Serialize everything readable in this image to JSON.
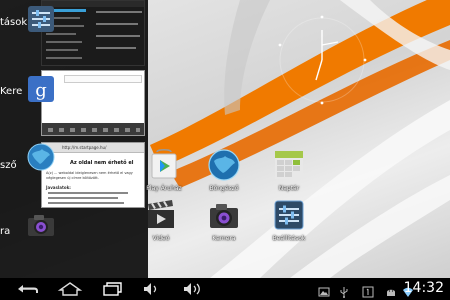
{
  "recents": [
    {
      "label": "tások",
      "icon": "settings-icon"
    },
    {
      "label": "Kere",
      "icon": "google-search-icon"
    },
    {
      "label": "sző",
      "icon": "browser-globe-icon"
    },
    {
      "label": "ra",
      "icon": "camera-icon"
    }
  ],
  "browser_thumb": {
    "url": "http://m.startpage.hu/",
    "heading": "Az oldal nem érhető el",
    "body": "A(z) ... weboldal ideiglenesen nem érhető el vagy véglegesen új címre költözött.",
    "suggestions_title": "Javaslatok:"
  },
  "home_apps": [
    {
      "label": "Play Áruház",
      "icon": "play-store-icon"
    },
    {
      "label": "Böngésző",
      "icon": "browser-globe-icon"
    },
    {
      "label": "Naptár",
      "icon": "calendar-icon"
    },
    {
      "label": "Videó",
      "icon": "video-icon"
    },
    {
      "label": "Kamera",
      "icon": "camera-icon"
    },
    {
      "label": "Beállítások",
      "icon": "settings-icon"
    }
  ],
  "statusbar": {
    "time": "14:32",
    "icons": [
      "image-icon",
      "usb-icon",
      "notification-1-icon",
      "android-icon",
      "wifi-icon"
    ]
  }
}
